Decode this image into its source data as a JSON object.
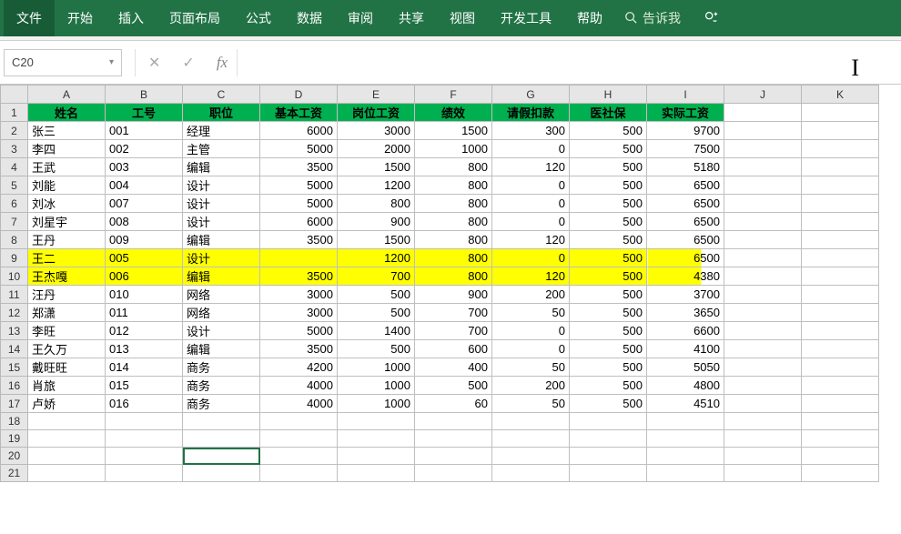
{
  "ribbon": {
    "tabs": [
      "文件",
      "开始",
      "插入",
      "页面布局",
      "公式",
      "数据",
      "审阅",
      "共享",
      "视图",
      "开发工具",
      "帮助"
    ],
    "tellme": "告诉我"
  },
  "namebox": {
    "value": "C20"
  },
  "fx": {
    "label": "fx",
    "value": ""
  },
  "columns": [
    "A",
    "B",
    "C",
    "D",
    "E",
    "F",
    "G",
    "H",
    "I",
    "J",
    "K"
  ],
  "header": [
    "姓名",
    "工号",
    "职位",
    "基本工资",
    "岗位工资",
    "绩效",
    "请假扣款",
    "医社保",
    "实际工资"
  ],
  "rows": [
    {
      "r": 2,
      "name": "张三",
      "id": "001",
      "pos": "经理",
      "base": "6000",
      "post": "3000",
      "perf": "1500",
      "leave": "300",
      "ins": "500",
      "net": "9700"
    },
    {
      "r": 3,
      "name": "李四",
      "id": "002",
      "pos": "主管",
      "base": "5000",
      "post": "2000",
      "perf": "1000",
      "leave": "0",
      "ins": "500",
      "net": "7500"
    },
    {
      "r": 4,
      "name": "王武",
      "id": "003",
      "pos": "编辑",
      "base": "3500",
      "post": "1500",
      "perf": "800",
      "leave": "120",
      "ins": "500",
      "net": "5180"
    },
    {
      "r": 5,
      "name": "刘能",
      "id": "004",
      "pos": "设计",
      "base": "5000",
      "post": "1200",
      "perf": "800",
      "leave": "0",
      "ins": "500",
      "net": "6500"
    },
    {
      "r": 6,
      "name": "刘冰",
      "id": "007",
      "pos": "设计",
      "base": "5000",
      "post": "800",
      "perf": "800",
      "leave": "0",
      "ins": "500",
      "net": "6500"
    },
    {
      "r": 7,
      "name": "刘星宇",
      "id": "008",
      "pos": "设计",
      "base": "6000",
      "post": "900",
      "perf": "800",
      "leave": "0",
      "ins": "500",
      "net": "6500"
    },
    {
      "r": 8,
      "name": "王丹",
      "id": "009",
      "pos": "编辑",
      "base": "3500",
      "post": "1500",
      "perf": "800",
      "leave": "120",
      "ins": "500",
      "net": "6500"
    },
    {
      "r": 9,
      "name": "王二",
      "id": "005",
      "pos": "设计",
      "base": "",
      "post": "1200",
      "perf": "800",
      "leave": "0",
      "ins": "500",
      "net": "6500",
      "hl": true
    },
    {
      "r": 10,
      "name": "王杰嘎",
      "id": "006",
      "pos": "编辑",
      "base": "3500",
      "post": "700",
      "perf": "800",
      "leave": "120",
      "ins": "500",
      "net": "4380",
      "hl": true
    },
    {
      "r": 11,
      "name": "汪丹",
      "id": "010",
      "pos": "网络",
      "base": "3000",
      "post": "500",
      "perf": "900",
      "leave": "200",
      "ins": "500",
      "net": "3700"
    },
    {
      "r": 12,
      "name": "郑潇",
      "id": "011",
      "pos": "网络",
      "base": "3000",
      "post": "500",
      "perf": "700",
      "leave": "50",
      "ins": "500",
      "net": "3650"
    },
    {
      "r": 13,
      "name": "李旺",
      "id": "012",
      "pos": "设计",
      "base": "5000",
      "post": "1400",
      "perf": "700",
      "leave": "0",
      "ins": "500",
      "net": "6600"
    },
    {
      "r": 14,
      "name": "王久万",
      "id": "013",
      "pos": "编辑",
      "base": "3500",
      "post": "500",
      "perf": "600",
      "leave": "0",
      "ins": "500",
      "net": "4100"
    },
    {
      "r": 15,
      "name": "戴旺旺",
      "id": "014",
      "pos": "商务",
      "base": "4200",
      "post": "1000",
      "perf": "400",
      "leave": "50",
      "ins": "500",
      "net": "5050"
    },
    {
      "r": 16,
      "name": "肖旅",
      "id": "015",
      "pos": "商务",
      "base": "4000",
      "post": "1000",
      "perf": "500",
      "leave": "200",
      "ins": "500",
      "net": "4800"
    },
    {
      "r": 17,
      "name": "卢娇",
      "id": "016",
      "pos": "商务",
      "base": "4000",
      "post": "1000",
      "perf": "60",
      "leave": "50",
      "ins": "500",
      "net": "4510"
    }
  ],
  "empty_rows": [
    18,
    19,
    20,
    21
  ],
  "selected_cell": "C20"
}
